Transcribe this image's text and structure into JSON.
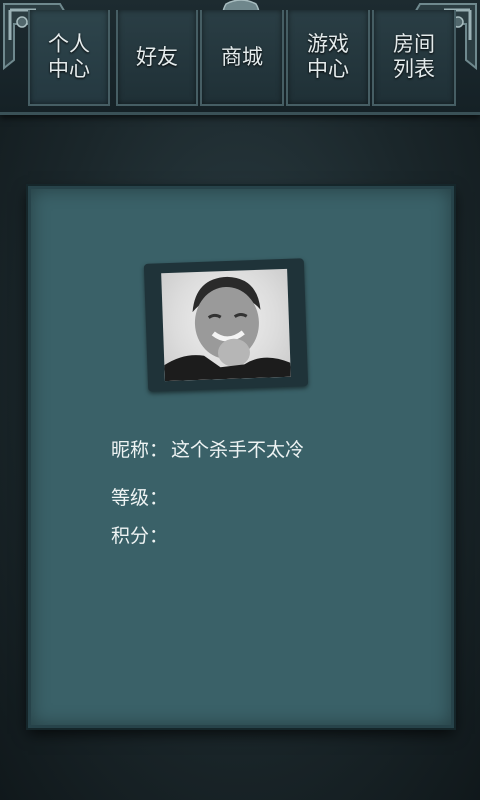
{
  "tabs": [
    {
      "label": "个人\n中心",
      "active": true
    },
    {
      "label": "好友",
      "active": false
    },
    {
      "label": "商城",
      "active": false
    },
    {
      "label": "游戏\n中心",
      "active": false
    },
    {
      "label": "房间\n列表",
      "active": false
    }
  ],
  "profile": {
    "nickname_label": "昵称：",
    "nickname_value": "这个杀手不太冷",
    "level_label": "等级：",
    "level_value": "",
    "score_label": "积分：",
    "score_value": ""
  },
  "colors": {
    "card": "#3a6168",
    "bar": "#1d2b30",
    "text": "#eef3f3"
  }
}
